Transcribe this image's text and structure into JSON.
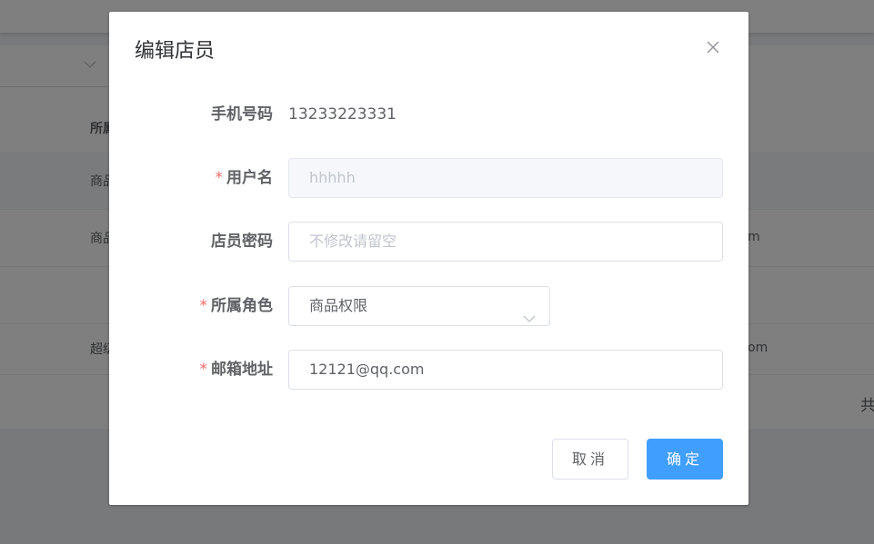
{
  "background": {
    "rows": [
      {
        "col1": "所属",
        "col2": "",
        "col3": ""
      },
      {
        "col1": "商品",
        "col2": "",
        "col3": ""
      },
      {
        "col1": "商品",
        "col2": "m",
        "col3": ""
      },
      {
        "col1": "",
        "col2": "",
        "col3": ""
      },
      {
        "col1": "超级",
        "col2": "om",
        "col3": ""
      },
      {
        "col1": "",
        "col2": "",
        "col3": "共"
      }
    ]
  },
  "dialog": {
    "title": "编辑店员",
    "close_icon": "close-icon",
    "fields": {
      "phone": {
        "label": "手机号码",
        "value": "13233223331"
      },
      "username": {
        "label": "用户名",
        "required": "*",
        "value": "hhhhh"
      },
      "password": {
        "label": "店员密码",
        "placeholder": "不修改请留空"
      },
      "role": {
        "label": "所属角色",
        "required": "*",
        "value": "商品权限"
      },
      "email": {
        "label": "邮箱地址",
        "required": "*",
        "value": "12121@qq.com"
      }
    },
    "buttons": {
      "cancel": "取消",
      "confirm": "确定"
    }
  },
  "colors": {
    "primary": "#409eff",
    "required": "#f56c6c",
    "text": "#606266",
    "placeholder": "#c0c4cc"
  }
}
